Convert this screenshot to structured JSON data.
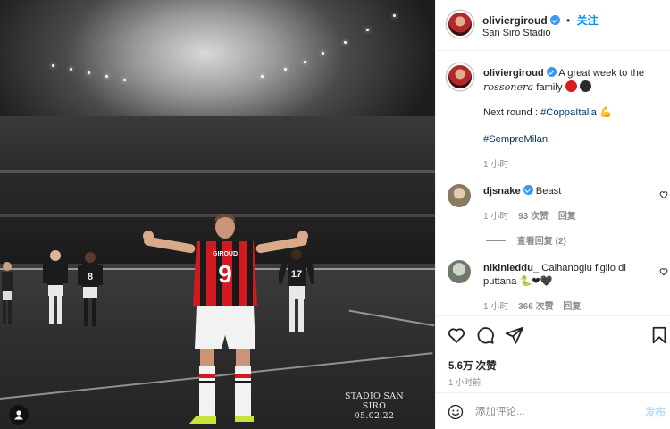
{
  "photo": {
    "caption_line1": "STADIO SAN SIRO",
    "caption_line2": "05.02.22",
    "player_number": "9",
    "player_name": "GIROUD",
    "other_numbers": [
      "8",
      "17"
    ]
  },
  "header": {
    "username": "oliviergiroud",
    "separator": "•",
    "follow_label": "关注",
    "location": "San Siro Stadio"
  },
  "caption": {
    "username": "oliviergiroud",
    "text_part1": "A great week to the",
    "text_italic": "rossonera",
    "text_part2": "family",
    "next_round_label": "Next round :",
    "next_round_tag": "#CoppaItalia",
    "flex_emoji": "💪",
    "tag2": "#SempreMilan",
    "time": "1 小时",
    "team_colors": [
      "#d91a21",
      "#2a2a2a"
    ]
  },
  "comments": [
    {
      "username": "djsnake",
      "verified": true,
      "text": "Beast",
      "time": "1 小时",
      "likes": "93 次赞",
      "reply_label": "回复",
      "view_replies": "查看回复 (2)"
    },
    {
      "username": "nikinieddu_",
      "verified": false,
      "text": "Calhanoglu figlio di puttana",
      "emojis": "🐍❤🖤",
      "time": "1 小时",
      "likes": "366 次赞",
      "reply_label": "回复"
    }
  ],
  "actions": {
    "likes_count": "5.6万 次赞",
    "posted_ago": "1 小时前"
  },
  "add_comment": {
    "placeholder": "添加评论...",
    "post_label": "发布"
  }
}
